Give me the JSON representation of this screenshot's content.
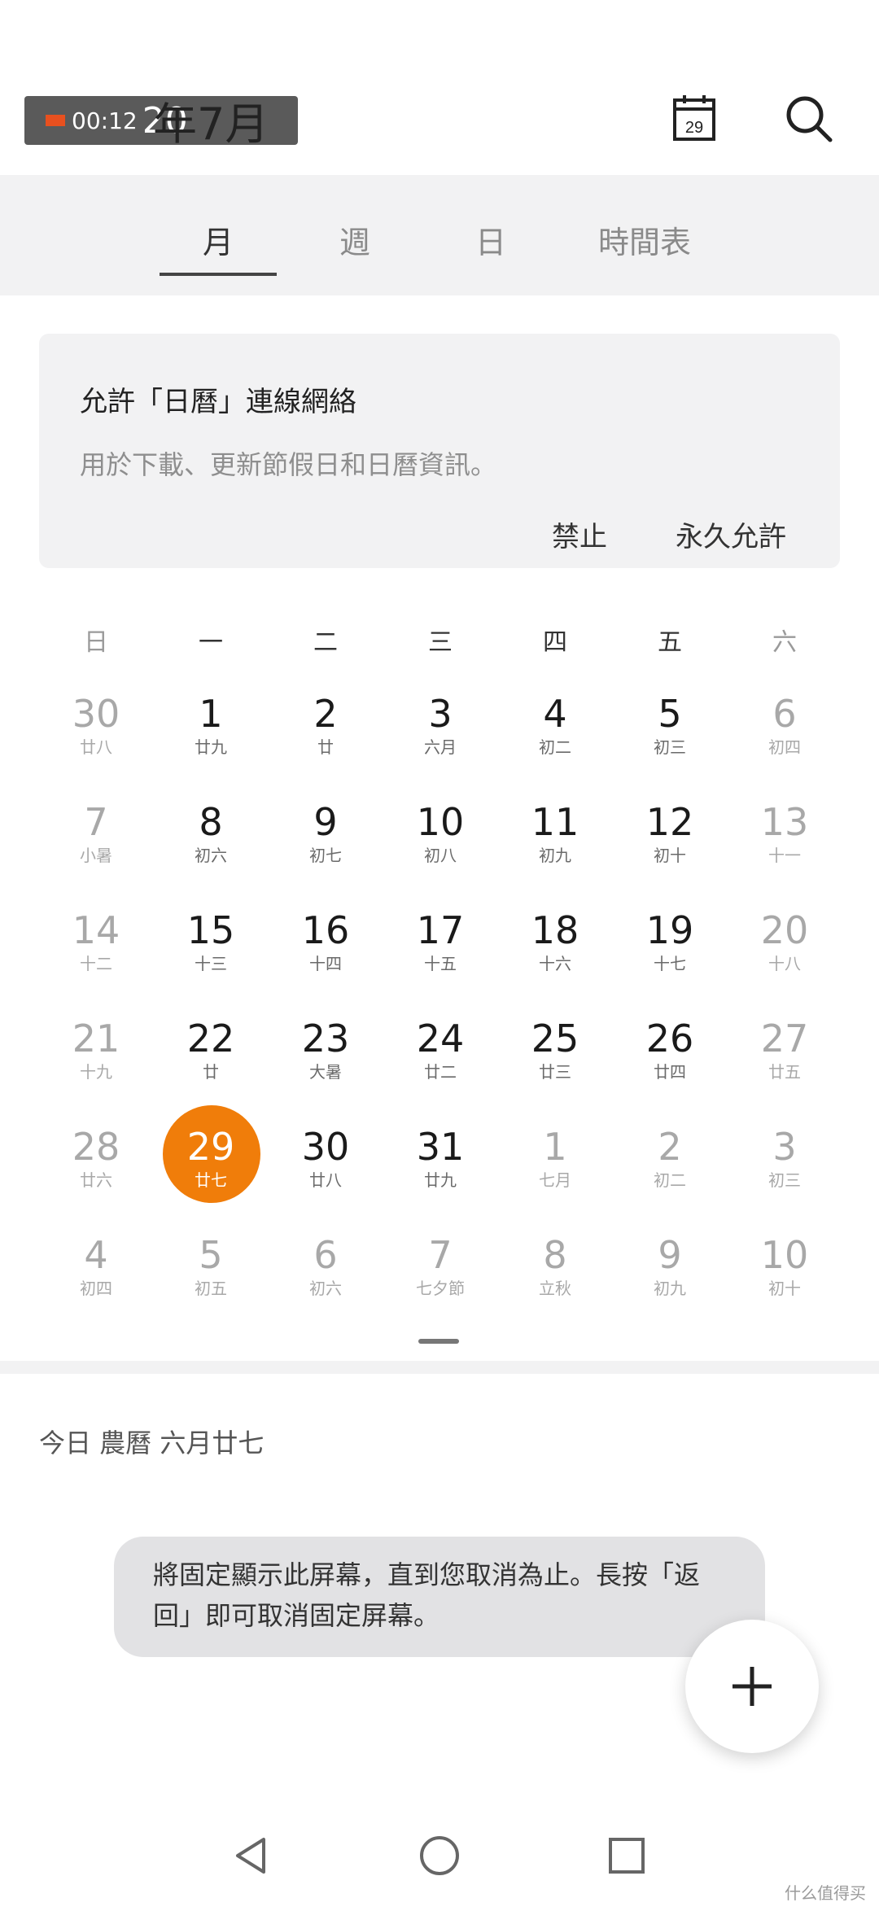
{
  "status": {
    "recording_time": "00:12",
    "overlay_text": "20"
  },
  "header": {
    "month_title": "年7月",
    "calendar_icon_day": "29"
  },
  "tabs": [
    {
      "label": "月",
      "active": true
    },
    {
      "label": "週",
      "active": false
    },
    {
      "label": "日",
      "active": false
    },
    {
      "label": "時間表",
      "active": false
    }
  ],
  "permission": {
    "title": "允許「日曆」連線網絡",
    "description": "用於下載、更新節假日和日曆資訊。",
    "deny_label": "禁止",
    "allow_label": "永久允許"
  },
  "weekdays": [
    "日",
    "一",
    "二",
    "三",
    "四",
    "五",
    "六"
  ],
  "weeks": [
    [
      {
        "d": "30",
        "l": "廿八",
        "m": true
      },
      {
        "d": "1",
        "l": "廿九"
      },
      {
        "d": "2",
        "l": "廿"
      },
      {
        "d": "3",
        "l": "六月"
      },
      {
        "d": "4",
        "l": "初二"
      },
      {
        "d": "5",
        "l": "初三"
      },
      {
        "d": "6",
        "l": "初四",
        "m": true
      }
    ],
    [
      {
        "d": "7",
        "l": "小暑",
        "m": true
      },
      {
        "d": "8",
        "l": "初六"
      },
      {
        "d": "9",
        "l": "初七"
      },
      {
        "d": "10",
        "l": "初八"
      },
      {
        "d": "11",
        "l": "初九"
      },
      {
        "d": "12",
        "l": "初十"
      },
      {
        "d": "13",
        "l": "十一",
        "m": true
      }
    ],
    [
      {
        "d": "14",
        "l": "十二",
        "m": true
      },
      {
        "d": "15",
        "l": "十三"
      },
      {
        "d": "16",
        "l": "十四"
      },
      {
        "d": "17",
        "l": "十五"
      },
      {
        "d": "18",
        "l": "十六"
      },
      {
        "d": "19",
        "l": "十七"
      },
      {
        "d": "20",
        "l": "十八",
        "m": true
      }
    ],
    [
      {
        "d": "21",
        "l": "十九",
        "m": true
      },
      {
        "d": "22",
        "l": "廿"
      },
      {
        "d": "23",
        "l": "大暑"
      },
      {
        "d": "24",
        "l": "廿二"
      },
      {
        "d": "25",
        "l": "廿三"
      },
      {
        "d": "26",
        "l": "廿四"
      },
      {
        "d": "27",
        "l": "廿五",
        "m": true
      }
    ],
    [
      {
        "d": "28",
        "l": "廿六",
        "m": true
      },
      {
        "d": "29",
        "l": "廿七",
        "t": true
      },
      {
        "d": "30",
        "l": "廿八"
      },
      {
        "d": "31",
        "l": "廿九"
      },
      {
        "d": "1",
        "l": "七月",
        "m": true
      },
      {
        "d": "2",
        "l": "初二",
        "m": true
      },
      {
        "d": "3",
        "l": "初三",
        "m": true
      }
    ],
    [
      {
        "d": "4",
        "l": "初四",
        "m": true
      },
      {
        "d": "5",
        "l": "初五",
        "m": true
      },
      {
        "d": "6",
        "l": "初六",
        "m": true
      },
      {
        "d": "7",
        "l": "七夕節",
        "m": true
      },
      {
        "d": "8",
        "l": "立秋",
        "m": true
      },
      {
        "d": "9",
        "l": "初九",
        "m": true
      },
      {
        "d": "10",
        "l": "初十",
        "m": true
      }
    ]
  ],
  "today_summary": "今日 農曆 六月廿七",
  "toast": "將固定顯示此屏幕，直到您取消為止。長按「返回」即可取消固定屏幕。",
  "watermark": "什么值得买",
  "colors": {
    "accent": "#f07d0a",
    "panel": "#f2f2f3"
  }
}
